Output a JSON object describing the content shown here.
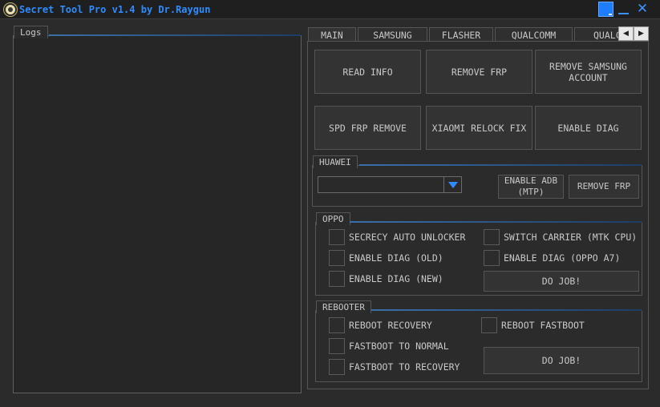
{
  "window": {
    "title": "Secret Tool Pro v1.4 by Dr.Raygun",
    "accent": "#2f8cff"
  },
  "logs": {
    "label": "Logs"
  },
  "tabs": [
    {
      "label": "MAIN",
      "active": true
    },
    {
      "label": "SAMSUNG"
    },
    {
      "label": "FLASHER"
    },
    {
      "label": "QUALCOMM"
    },
    {
      "label": "QUALC"
    }
  ],
  "main": {
    "buttons": [
      "READ INFO",
      "REMOVE FRP",
      "REMOVE SAMSUNG ACCOUNT",
      "SPD FRP REMOVE",
      "XIAOMI RELOCK FIX",
      "ENABLE DIAG"
    ]
  },
  "huawei": {
    "label": "HUAWEI",
    "enable_adb": "ENABLE ADB (MTP)",
    "remove_frp": "REMOVE FRP"
  },
  "oppo": {
    "label": "OPPO",
    "options": [
      "SECRECY AUTO UNLOCKER",
      "ENABLE DIAG (OLD)",
      "ENABLE DIAG (NEW)",
      "SWITCH CARRIER (MTK CPU)",
      "ENABLE DIAG (OPPO A7)"
    ],
    "do_job": "DO JOB!"
  },
  "rebooter": {
    "label": "REBOOTER",
    "options": [
      "REBOOT RECOVERY",
      "FASTBOOT TO NORMAL",
      "FASTBOOT TO RECOVERY",
      "REBOOT FASTBOOT"
    ],
    "do_job": "DO JOB!"
  }
}
